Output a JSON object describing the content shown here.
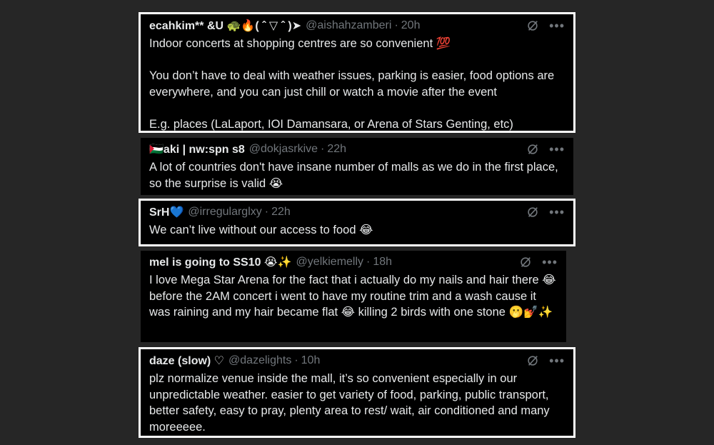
{
  "tweets": [
    {
      "name": "ecahkim** &U 🐢🔥( ˆ ▽ ˆ )➤",
      "handle": "@aishahzamberi",
      "sep": "·",
      "time": "20h",
      "text": "Indoor concerts at shopping centres are so convenient 💯\n\nYou don’t have to deal with weather issues, parking is easier, food options are everywhere, and you can just chill or watch a movie after the event\n\nE.g. places (LaLaport, IOI Damansara, or Arena of Stars Genting, etc)"
    },
    {
      "name": "🇵🇸aki | nw:spn s8",
      "handle": "@dokjasrkive",
      "sep": "·",
      "time": "22h",
      "text": "A lot of countries don't have insane number of malls as we do in the first place, so the surprise is valid 😭"
    },
    {
      "name": "SrH💙",
      "handle": "@irregularglxy",
      "sep": "·",
      "time": "22h",
      "text": "We can’t live without our access to food 😂"
    },
    {
      "name": "mel is going to SS10 😭✨",
      "handle": "@yelkiemelly",
      "sep": "·",
      "time": "18h",
      "text": "I love Mega Star Arena for the fact that i actually do my nails and hair there 😂 before the 2AM concert i went to have my routine trim and a wash cause it was raining and my hair became flat 😂 killing 2 birds with one stone 🫢💅✨"
    },
    {
      "name": "daze (slow) ♡",
      "handle": "@dazelights",
      "sep": "·",
      "time": "10h",
      "text": "plz normalize venue inside the mall, it’s so convenient especially in our unpredictable weather. easier to get variety of food, parking, public transport, better safety, easy to pray, plenty area to rest/ wait, air conditioned and many moreeeee."
    }
  ],
  "icons": {
    "grok": "grok-icon",
    "more": "more-options-icon"
  }
}
